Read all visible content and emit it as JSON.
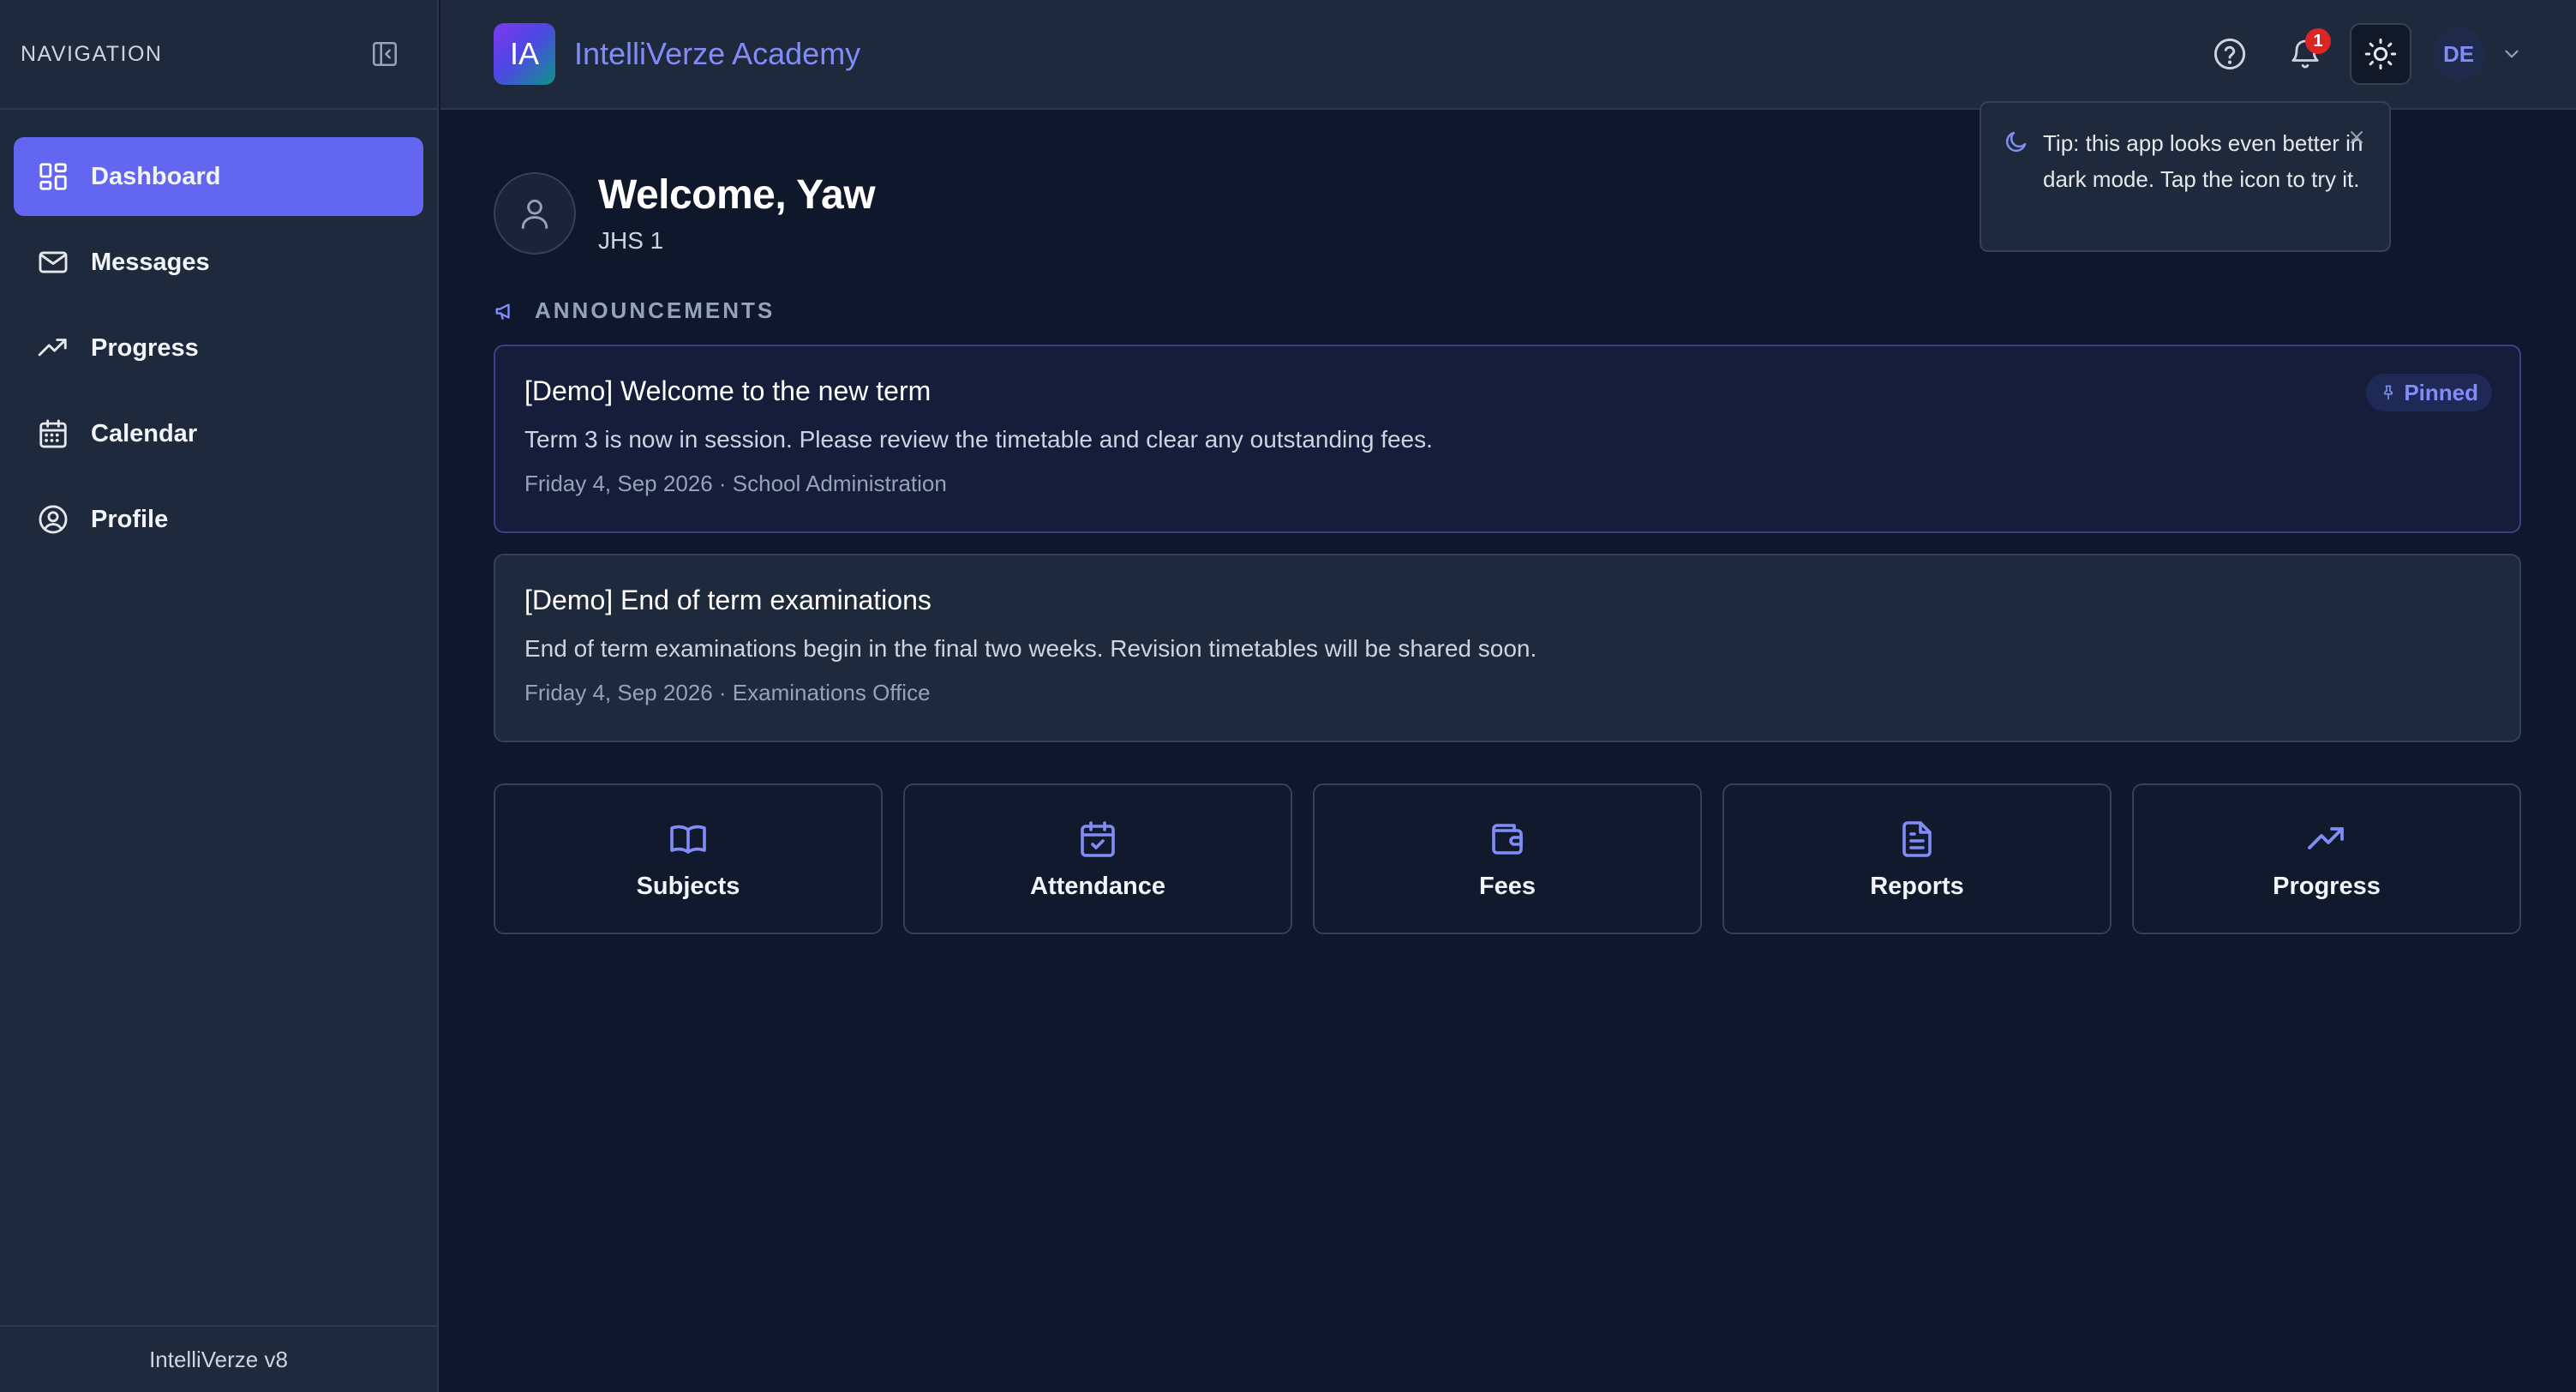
{
  "sidebar": {
    "title": "NAVIGATION",
    "items": [
      {
        "label": "Dashboard",
        "icon": "dashboard-icon",
        "active": true
      },
      {
        "label": "Messages",
        "icon": "mail-icon"
      },
      {
        "label": "Progress",
        "icon": "trending-up-icon"
      },
      {
        "label": "Calendar",
        "icon": "calendar-icon"
      },
      {
        "label": "Profile",
        "icon": "user-circle-icon"
      }
    ],
    "footer": "IntelliVerze v8"
  },
  "header": {
    "logo_text": "IA",
    "app_name": "IntelliVerze Academy",
    "notification_count": "1",
    "avatar_initials": "DE"
  },
  "tooltip": {
    "text": "Tip: this app looks even better in dark mode. Tap the icon to try it."
  },
  "main": {
    "welcome_title": "Welcome, Yaw",
    "welcome_sub": "JHS 1",
    "announcements_label": "ANNOUNCEMENTS",
    "announcements": [
      {
        "title": "[Demo] Welcome to the new term",
        "body": "Term 3 is now in session. Please review the timetable and clear any outstanding fees.",
        "meta": "Friday 4, Sep 2026 · School Administration",
        "pinned_label": "Pinned"
      },
      {
        "title": "[Demo] End of term examinations",
        "body": "End of term examinations begin in the final two weeks. Revision timetables will be shared soon.",
        "meta": "Friday 4, Sep 2026 · Examinations Office"
      }
    ],
    "tiles": [
      {
        "label": "Subjects",
        "icon": "book-open-icon"
      },
      {
        "label": "Attendance",
        "icon": "calendar-check-icon"
      },
      {
        "label": "Fees",
        "icon": "wallet-icon"
      },
      {
        "label": "Reports",
        "icon": "document-icon"
      },
      {
        "label": "Progress",
        "icon": "trending-up-icon"
      }
    ]
  },
  "colors": {
    "accent": "#6366f1",
    "accent_text": "#818cf8",
    "background": "#0f172a",
    "panel": "#1e293b",
    "badge": "#dc2626"
  }
}
